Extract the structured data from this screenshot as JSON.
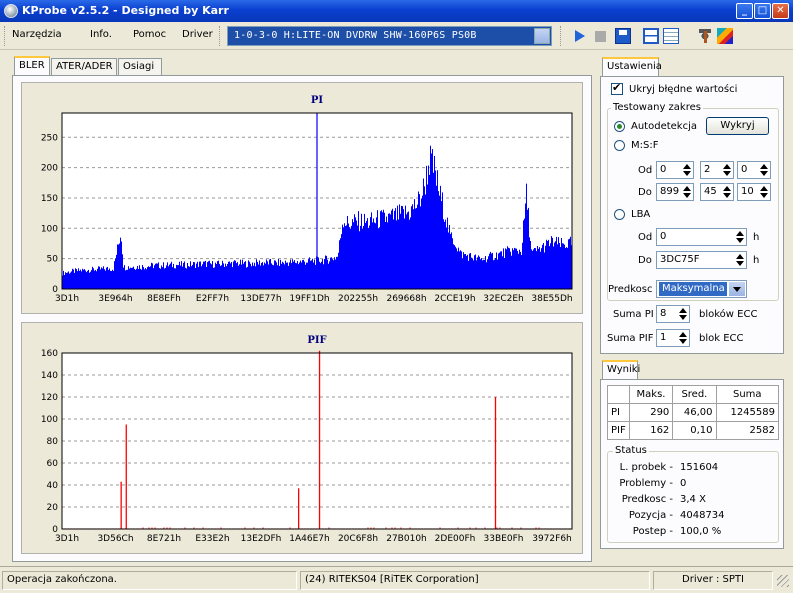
{
  "window": {
    "title": "KProbe v2.5.2 - Designed by Karr"
  },
  "menu": {
    "tools": "Narzędzia",
    "info": "Info.",
    "help": "Pomoc",
    "driver": "Driver"
  },
  "drive_selector": {
    "value": "1-0-3-0 H:LITE-ON DVDRW SHW-160P6S PS0B"
  },
  "tabs": {
    "bler": "BLER",
    "ater": "ATER/ADER",
    "perf": "Osiagi"
  },
  "settings": {
    "tab": "Ustawienia",
    "hide_errors": "Ukryj błędne wartości",
    "range_group": "Testowany zakres",
    "auto": "Autodetekcja",
    "detect_btn": "Wykryj",
    "msf": "M:S:F",
    "from": "Od",
    "to": "Do",
    "msf_from": [
      "0",
      "2",
      "0"
    ],
    "msf_to": [
      "899",
      "45",
      "10"
    ],
    "lba": "LBA",
    "lba_from": "0",
    "lba_to": "3DC75F",
    "h": "h",
    "speed_label": "Predkosc",
    "speed_value": "Maksymalna",
    "sum_pi_label": "Suma PI",
    "sum_pi_value": "8",
    "sum_pi_unit": "bloków ECC",
    "sum_pif_label": "Suma PIF",
    "sum_pif_value": "1",
    "sum_pif_unit": "blok ECC"
  },
  "results": {
    "tab": "Wyniki",
    "headers": [
      "",
      "Maks.",
      "Sred.",
      "Suma"
    ],
    "rows": [
      [
        "PI",
        "290",
        "46,00",
        "1245589"
      ],
      [
        "PIF",
        "162",
        "0,10",
        "2582"
      ]
    ],
    "status_title": "Status",
    "status": [
      {
        "label": "L. probek -",
        "value": "151604"
      },
      {
        "label": "Problemy -",
        "value": "0"
      },
      {
        "label": "Predkosc -",
        "value": "3,4  X"
      },
      {
        "label": "Pozycja -",
        "value": "4048734"
      },
      {
        "label": "Postep -",
        "value": "100,0 %"
      }
    ]
  },
  "statusbar": {
    "left": "Operacja zakończona.",
    "mid": "(24) RITEKS04 [RiTEK Corporation]",
    "right": "Driver : SPTI"
  },
  "colors": {
    "pi": "#0000ff",
    "pif": "#ff0000",
    "chart_bg": "#ffffff",
    "title_bar": "#0a3fcf"
  },
  "chart_data": [
    {
      "type": "bar",
      "title": "PI",
      "ylim": [
        0,
        290
      ],
      "yticks": [
        0,
        50,
        100,
        150,
        200,
        250
      ],
      "x_tick_labels": [
        "3D1h",
        "3E964h",
        "8E8EFh",
        "E2FF7h",
        "13DE77h",
        "19FF1Dh",
        "202255h",
        "269668h",
        "2CCE19h",
        "32EC2Eh",
        "38E55Dh"
      ],
      "x": [
        0,
        0.02,
        0.04,
        0.06,
        0.08,
        0.1,
        0.115,
        0.12,
        0.14,
        0.16,
        0.18,
        0.2,
        0.22,
        0.24,
        0.26,
        0.28,
        0.3,
        0.32,
        0.34,
        0.36,
        0.38,
        0.4,
        0.42,
        0.44,
        0.46,
        0.48,
        0.5,
        0.52,
        0.54,
        0.55,
        0.56,
        0.58,
        0.6,
        0.62,
        0.64,
        0.66,
        0.68,
        0.7,
        0.71,
        0.72,
        0.73,
        0.74,
        0.75,
        0.76,
        0.77,
        0.78,
        0.8,
        0.82,
        0.84,
        0.86,
        0.88,
        0.9,
        0.91,
        0.92,
        0.94,
        0.96,
        0.98,
        1
      ],
      "values": [
        27,
        30,
        32,
        33,
        34,
        35,
        98,
        37,
        38,
        38,
        40,
        40,
        41,
        41,
        42,
        43,
        42,
        43,
        44,
        43,
        44,
        45,
        44,
        45,
        46,
        47,
        48,
        50,
        55,
        120,
        110,
        115,
        113,
        118,
        120,
        125,
        130,
        150,
        175,
        220,
        200,
        160,
        130,
        90,
        80,
        60,
        55,
        50,
        55,
        60,
        65,
        65,
        160,
        60,
        70,
        80,
        75,
        78
      ],
      "peak_values": [
        {
          "x": 0.5,
          "value": 290
        }
      ]
    },
    {
      "type": "bar",
      "title": "PIF",
      "ylim": [
        0,
        160
      ],
      "yticks": [
        0,
        20,
        40,
        60,
        80,
        100,
        120,
        140,
        160
      ],
      "x_tick_labels": [
        "3D1h",
        "3D56Ch",
        "8E721h",
        "E33E2h",
        "13E2DFh",
        "1A46E7h",
        "20C6F8h",
        "27B010h",
        "2DE00Fh",
        "33BE0Fh",
        "3972F6h"
      ],
      "spikes": [
        {
          "x": 0.116,
          "value": 43
        },
        {
          "x": 0.126,
          "value": 95
        },
        {
          "x": 0.464,
          "value": 37
        },
        {
          "x": 0.505,
          "value": 162
        },
        {
          "x": 0.85,
          "value": 120
        }
      ]
    }
  ]
}
